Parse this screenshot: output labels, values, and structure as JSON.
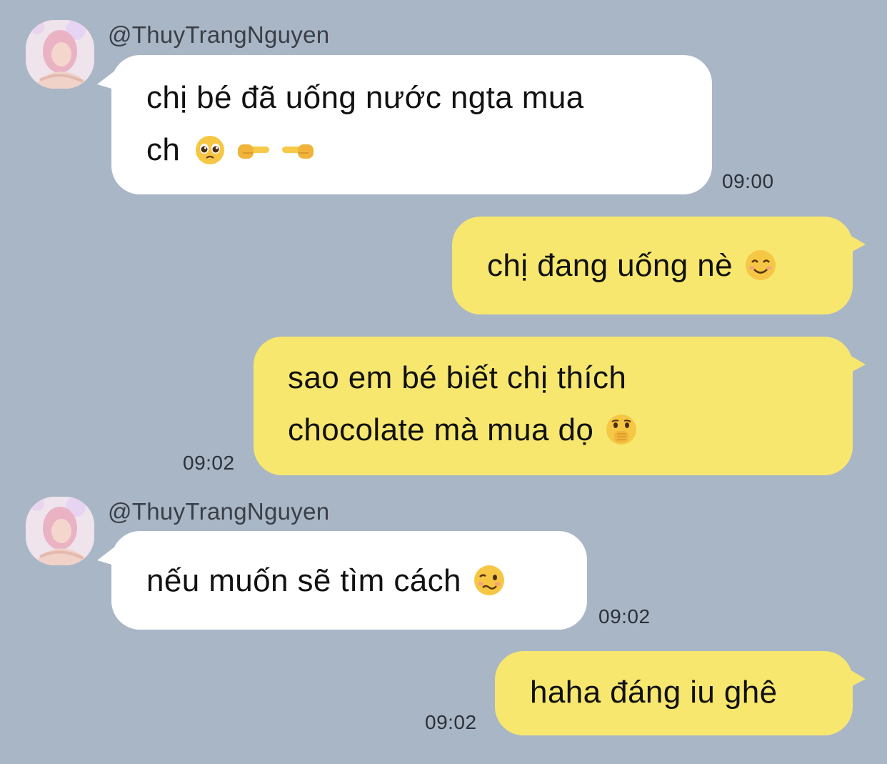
{
  "contact": {
    "handle": "@ThuyTrangNguyen"
  },
  "messages": [
    {
      "direction": "incoming",
      "lines": [
        "chị bé đã uống nước ngta mua",
        "ch"
      ],
      "emojis": [
        "pleading-face-emoji",
        "finger-pointing-right-emoji",
        "finger-pointing-left-emoji"
      ],
      "time": "09:00"
    },
    {
      "direction": "outgoing",
      "lines": [
        "chị đang uống nè"
      ],
      "emojis": [
        "smiling-face-emoji"
      ],
      "time": ""
    },
    {
      "direction": "outgoing",
      "lines": [
        "sao em bé biết chị thích",
        "chocolate mà mua dọ"
      ],
      "emojis": [
        "face-with-hand-over-mouth-emoji"
      ],
      "time": "09:02"
    },
    {
      "direction": "incoming",
      "lines": [
        "nếu muốn sẽ tìm cách"
      ],
      "emojis": [
        "woozy-face-emoji"
      ],
      "time": "09:02"
    },
    {
      "direction": "outgoing",
      "lines": [
        "haha đáng iu ghê"
      ],
      "emojis": [],
      "time": "09:02"
    }
  ],
  "colors": {
    "background": "#a9b6c6",
    "incoming_bubble": "#ffffff",
    "outgoing_bubble": "#f7e76f",
    "text": "#111111"
  }
}
